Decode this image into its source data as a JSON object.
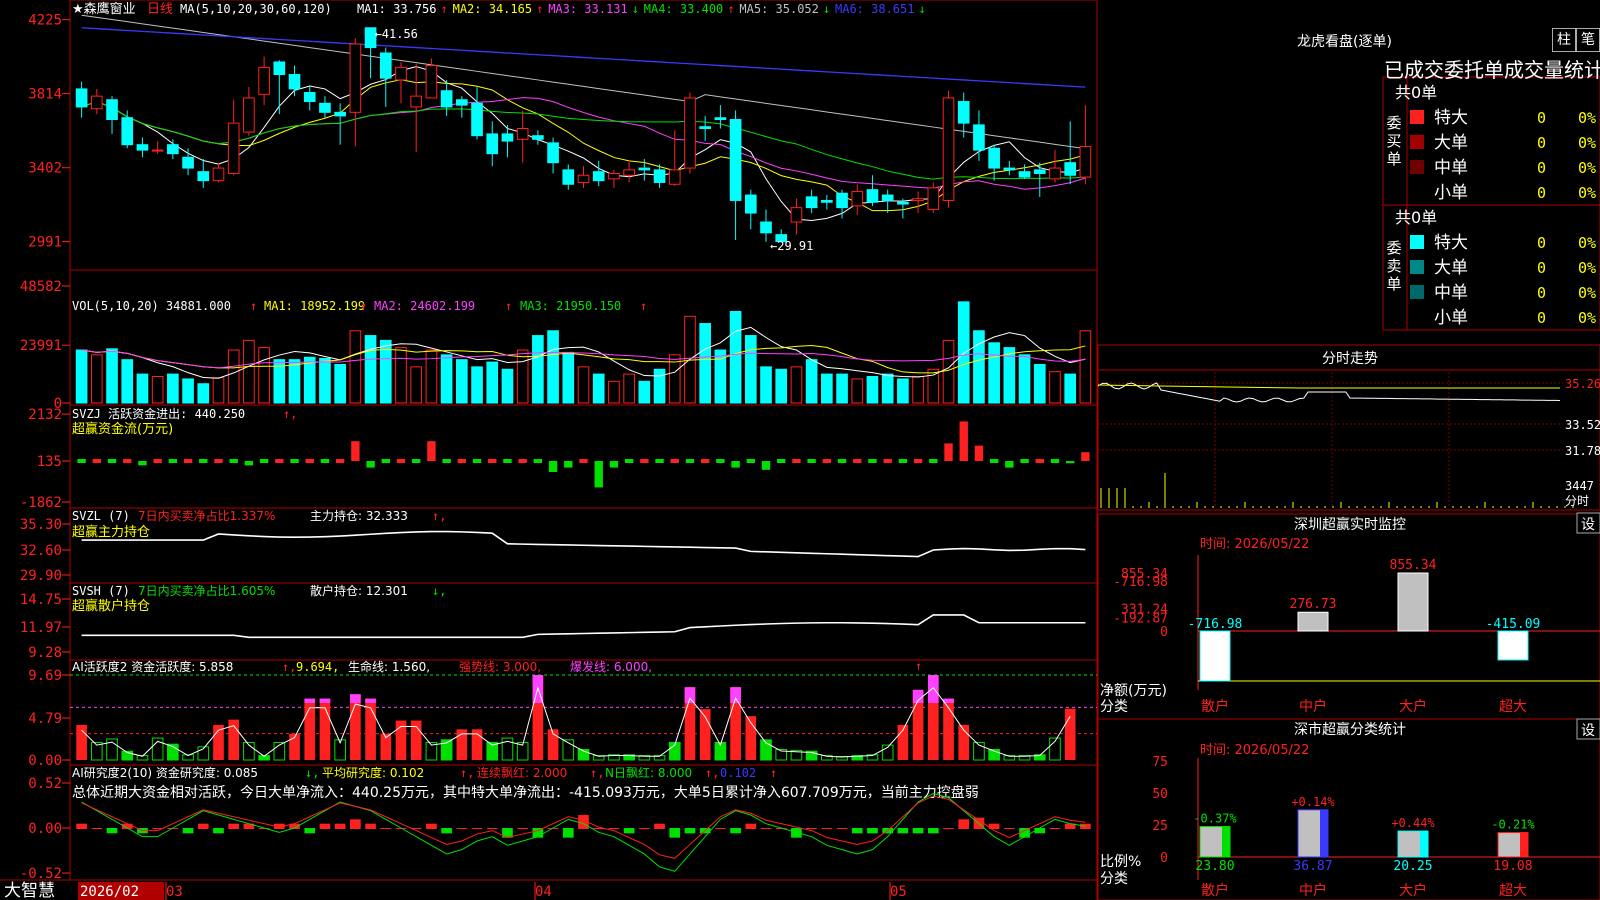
{
  "stock": {
    "name": "森鹰窗业",
    "period": "日线"
  },
  "colors": {
    "up": "#ff2020",
    "down": "#00ffff",
    "bull": "#ff2020",
    "bear": "#00ffff",
    "green": "#00e000",
    "white": "#ffffff",
    "yellow": "#ffff00",
    "magenta": "#ff40ff",
    "blue": "#3a3aff",
    "gray": "#c0c0c0",
    "frame": "#b00000"
  },
  "header": {
    "ma_params": "MA(5,10,20,30,60,120)",
    "items": [
      {
        "label": "MA1: 33.756",
        "arrow": "↑",
        "color": "#ffffff"
      },
      {
        "label": "MA2: 34.165",
        "arrow": "↑",
        "color": "#ffff00"
      },
      {
        "label": "MA3: 33.131",
        "arrow": "↓",
        "color": "#ff40ff"
      },
      {
        "label": "MA4: 33.400",
        "arrow": "↑",
        "color": "#00e000"
      },
      {
        "label": "MA5: 35.052",
        "arrow": "↓",
        "color": "#c0c0c0"
      },
      {
        "label": "MA6: 38.651",
        "arrow": "↓",
        "color": "#3a3aff"
      }
    ]
  },
  "price_axis": {
    "ticks": [
      "4225",
      "3814",
      "3402",
      "2991"
    ],
    "high_label": "41.56",
    "low_label": "29.91"
  },
  "vol_panel": {
    "title": "VOL(5,10,20)",
    "value": "34881.000",
    "arrow": "↑",
    "ma1": "MA1: 18952.199",
    "ma2": "MA2: 24602.199",
    "ma3": "MA3: 21950.150",
    "ticks": [
      "48582",
      "23991",
      "0"
    ]
  },
  "svzj_panel": {
    "title": "SVZJ",
    "sub": "活跃资金进出: 440.250",
    "arrow": "↑",
    "label": "超赢资金流(万元)",
    "ticks": [
      "2132",
      "135",
      "-1862"
    ]
  },
  "svzl_panel": {
    "title": "SVZL (7)",
    "pct": "7日内买卖净占比1.337%",
    "hold": "主力持仓: 32.333",
    "arrow": "↑",
    "label": "超赢主力持仓",
    "ticks": [
      "35.30",
      "32.60",
      "29.90"
    ]
  },
  "svsh_panel": {
    "title": "SVSH (7)",
    "pct": "7日内买卖净占比1.605%",
    "hold": "散户持仓: 12.301",
    "arrow": "↓",
    "label": "超赢散户持仓",
    "ticks": [
      "14.75",
      "11.97",
      "9.28"
    ]
  },
  "ai_active": {
    "title": "AI活跃度2",
    "val": "资金活跃度: 5.858",
    "v2": "9.694,",
    "life": "生命线: 1.560,",
    "strong": "强势线: 3.000,",
    "burst": "爆发线: 6.000,",
    "ticks": [
      "9.69",
      "4.79",
      "0.00"
    ]
  },
  "ai_research": {
    "title": "AI研究度2(10)",
    "r1": "资金研究度: 0.085",
    "r2": "平均研究度: 0.102",
    "r3": "连续飘红: 2.000",
    "r4": "N日飘红: 8.000",
    "r5": "0.102",
    "summary": "总体近期大资金相对活跃，今日大单净流入：440.25万元，其中特大单净流出：-415.093万元，大单5日累计净入607.709万元，当前主力控盘弱",
    "ticks": [
      "0.52",
      "0.00",
      "-0.52"
    ]
  },
  "bottom": {
    "brand": "大智慧",
    "date": "2026/02",
    "m1": "03",
    "m2": "04",
    "m3": "05"
  },
  "right": {
    "dragon_title": "龙虎看盘(逐单)",
    "btn_col": "柱",
    "btn_pen": "笔",
    "stat_title": "已成交委托单成交量统计",
    "buy": {
      "side": "委买单",
      "total": "共0单",
      "rows": [
        {
          "label": "特大",
          "v": "0",
          "p": "0%",
          "c": "#ff2020"
        },
        {
          "label": "大单",
          "v": "0",
          "p": "0%",
          "c": "#a00000"
        },
        {
          "label": "中单",
          "v": "0",
          "p": "0%",
          "c": "#700000"
        },
        {
          "label": "小单",
          "v": "0",
          "p": "0%",
          "c": ""
        }
      ]
    },
    "sell": {
      "side": "委卖单",
      "total": "共0单",
      "rows": [
        {
          "label": "特大",
          "v": "0",
          "p": "0%",
          "c": "#00ffff"
        },
        {
          "label": "大单",
          "v": "0",
          "p": "0%",
          "c": "#008888"
        },
        {
          "label": "中单",
          "v": "0",
          "p": "0%",
          "c": "#006868"
        },
        {
          "label": "小单",
          "v": "0",
          "p": "0%",
          "c": ""
        }
      ]
    },
    "intraday": {
      "title": "分时走势",
      "ticks": [
        "35.26",
        "33.52",
        "31.78",
        "3447",
        "分时"
      ]
    },
    "monitor": {
      "title": "深圳超赢实时监控",
      "btn": "设",
      "time": "时间: 2026/05/22",
      "ticks": [
        "855.34",
        "331.24",
        "0",
        "-192.87",
        "-716.98"
      ],
      "ylabel": "净额(万元)",
      "xlabel": "分类",
      "bars": [
        {
          "cat": "散户",
          "v": -716.98,
          "label": "-716.98"
        },
        {
          "cat": "中户",
          "v": 276.73,
          "label": "276.73"
        },
        {
          "cat": "大户",
          "v": 855.34,
          "label": "855.34"
        },
        {
          "cat": "超大",
          "v": -415.09,
          "label": "-415.09"
        }
      ]
    },
    "classify": {
      "title": "深市超赢分类统计",
      "btn": "设",
      "time": "时间: 2026/05/22",
      "ticks": [
        "75",
        "50",
        "25",
        "0"
      ],
      "ylabel": "比例%",
      "xlabel": "分类",
      "bars": [
        {
          "cat": "散户",
          "v": 23.8,
          "chg": "-0.37%",
          "label": "23.80"
        },
        {
          "cat": "中户",
          "v": 36.87,
          "chg": "+0.14%",
          "label": "36.87"
        },
        {
          "cat": "大户",
          "v": 20.25,
          "chg": "+0.44%",
          "label": "20.25"
        },
        {
          "cat": "超大",
          "v": 19.08,
          "chg": "-0.21%",
          "label": "19.08"
        }
      ]
    }
  },
  "chart_data": [
    {
      "type": "candlestick",
      "title": "森鹰窗业 日线",
      "ylim": [
        29.0,
        42.9
      ],
      "series": [
        {
          "name": "OHLC",
          "values": [
            [
              38.4,
              37.4,
              38.8,
              36.8
            ],
            [
              37.3,
              38.0,
              38.4,
              37.0
            ],
            [
              37.8,
              36.7,
              38.0,
              35.9
            ],
            [
              36.8,
              35.3,
              37.2,
              35.1
            ],
            [
              35.3,
              35.0,
              35.7,
              34.6
            ],
            [
              35.0,
              35.0,
              35.5,
              34.8
            ],
            [
              35.3,
              34.8,
              35.6,
              34.5
            ],
            [
              34.6,
              34.0,
              35.1,
              33.6
            ],
            [
              33.8,
              33.3,
              34.5,
              32.9
            ],
            [
              33.3,
              34.0,
              34.3,
              33.2
            ],
            [
              33.7,
              36.5,
              37.8,
              33.6
            ],
            [
              36.0,
              37.9,
              38.5,
              35.8
            ],
            [
              38.1,
              39.6,
              40.2,
              37.5
            ],
            [
              39.9,
              39.2,
              40.0,
              37.0
            ],
            [
              39.2,
              38.4,
              39.7,
              38.0
            ],
            [
              38.2,
              37.7,
              38.6,
              37.2
            ],
            [
              37.6,
              37.1,
              38.0,
              36.8
            ],
            [
              37.1,
              36.9,
              37.6,
              35.3
            ],
            [
              37.1,
              40.9,
              41.2,
              35.2
            ],
            [
              41.8,
              40.7,
              41.56,
              39.0
            ],
            [
              40.4,
              39.0,
              40.7,
              37.4
            ],
            [
              38.9,
              39.6,
              39.9,
              37.6
            ],
            [
              37.4,
              38.0,
              39.8,
              34.9
            ],
            [
              37.9,
              39.7,
              40.1,
              37.9
            ],
            [
              38.3,
              37.4,
              38.9,
              36.9
            ],
            [
              37.8,
              37.5,
              38.0,
              36.8
            ],
            [
              37.6,
              35.8,
              38.5,
              35.6
            ],
            [
              35.9,
              34.8,
              36.6,
              34.1
            ],
            [
              35.9,
              35.5,
              36.4,
              34.6
            ],
            [
              35.6,
              36.2,
              37.2,
              34.3
            ],
            [
              35.8,
              35.6,
              36.1,
              35.3
            ],
            [
              35.4,
              34.3,
              35.7,
              33.7
            ],
            [
              33.9,
              33.1,
              34.2,
              32.8
            ],
            [
              33.2,
              33.6,
              34.1,
              32.9
            ],
            [
              33.8,
              33.3,
              34.4,
              33.0
            ],
            [
              33.4,
              33.7,
              33.9,
              32.9
            ],
            [
              33.6,
              33.9,
              34.4,
              33.2
            ],
            [
              34.0,
              33.9,
              34.5,
              33.3
            ],
            [
              33.9,
              33.2,
              34.2,
              32.9
            ],
            [
              33.1,
              33.9,
              36.1,
              33.0
            ],
            [
              34.0,
              37.9,
              38.2,
              33.7
            ],
            [
              36.3,
              36.2,
              36.9,
              35.5
            ],
            [
              36.8,
              36.7,
              37.5,
              36.2
            ],
            [
              36.7,
              32.2,
              37.2,
              30.0
            ],
            [
              32.5,
              31.5,
              32.8,
              30.6
            ],
            [
              31.0,
              30.4,
              31.7,
              29.9
            ],
            [
              30.3,
              29.91,
              30.6,
              29.9
            ],
            [
              31.0,
              31.8,
              32.3,
              30.3
            ],
            [
              32.4,
              31.8,
              32.8,
              31.5
            ],
            [
              32.2,
              32.1,
              32.5,
              31.7
            ],
            [
              32.6,
              31.8,
              32.8,
              31.2
            ],
            [
              31.9,
              32.7,
              33.1,
              31.4
            ],
            [
              32.8,
              32.1,
              33.6,
              31.9
            ],
            [
              32.5,
              32.2,
              32.8,
              31.5
            ],
            [
              32.1,
              32.0,
              32.3,
              31.2
            ],
            [
              32.2,
              32.3,
              32.7,
              31.5
            ],
            [
              31.7,
              32.9,
              33.2,
              31.5
            ],
            [
              32.2,
              37.9,
              38.3,
              31.8
            ],
            [
              37.7,
              36.5,
              38.2,
              35.7
            ],
            [
              36.4,
              35.0,
              37.2,
              34.4
            ],
            [
              35.1,
              34.0,
              35.3,
              33.3
            ],
            [
              34.0,
              33.9,
              34.4,
              33.6
            ],
            [
              33.8,
              33.5,
              34.2,
              33.4
            ],
            [
              33.9,
              33.7,
              34.3,
              32.4
            ],
            [
              33.4,
              34.0,
              35.0,
              33.2
            ],
            [
              34.3,
              33.6,
              36.6,
              33.1
            ],
            [
              33.5,
              35.2,
              37.5,
              33.1
            ]
          ]
        }
      ],
      "ma_values": {
        "MA1": 33.756,
        "MA2": 34.165,
        "MA3": 33.131,
        "MA4": 33.4,
        "MA5": 35.052,
        "MA6": 38.651
      }
    },
    {
      "type": "bar",
      "title": "VOL(5,10,20)",
      "ylim": [
        0,
        48582
      ],
      "values": [
        22000,
        20000,
        22500,
        18000,
        12000,
        11000,
        12000,
        10000,
        8000,
        10500,
        22000,
        26000,
        23000,
        18000,
        18000,
        19000,
        18500,
        16000,
        30000,
        28000,
        26000,
        23000,
        15000,
        22000,
        20000,
        18000,
        15000,
        17000,
        14000,
        22000,
        28000,
        30000,
        21000,
        15000,
        12000,
        9000,
        12000,
        9000,
        14000,
        20000,
        36000,
        33000,
        22000,
        38000,
        28000,
        15000,
        14000,
        15000,
        18000,
        12000,
        12000,
        10000,
        11000,
        12000,
        10000,
        11000,
        14000,
        26000,
        42000,
        30000,
        25000,
        23000,
        20000,
        16000,
        13000,
        12000,
        30000
      ],
      "series_ma": [
        "MA1",
        "MA2",
        "MA3"
      ]
    }
  ]
}
